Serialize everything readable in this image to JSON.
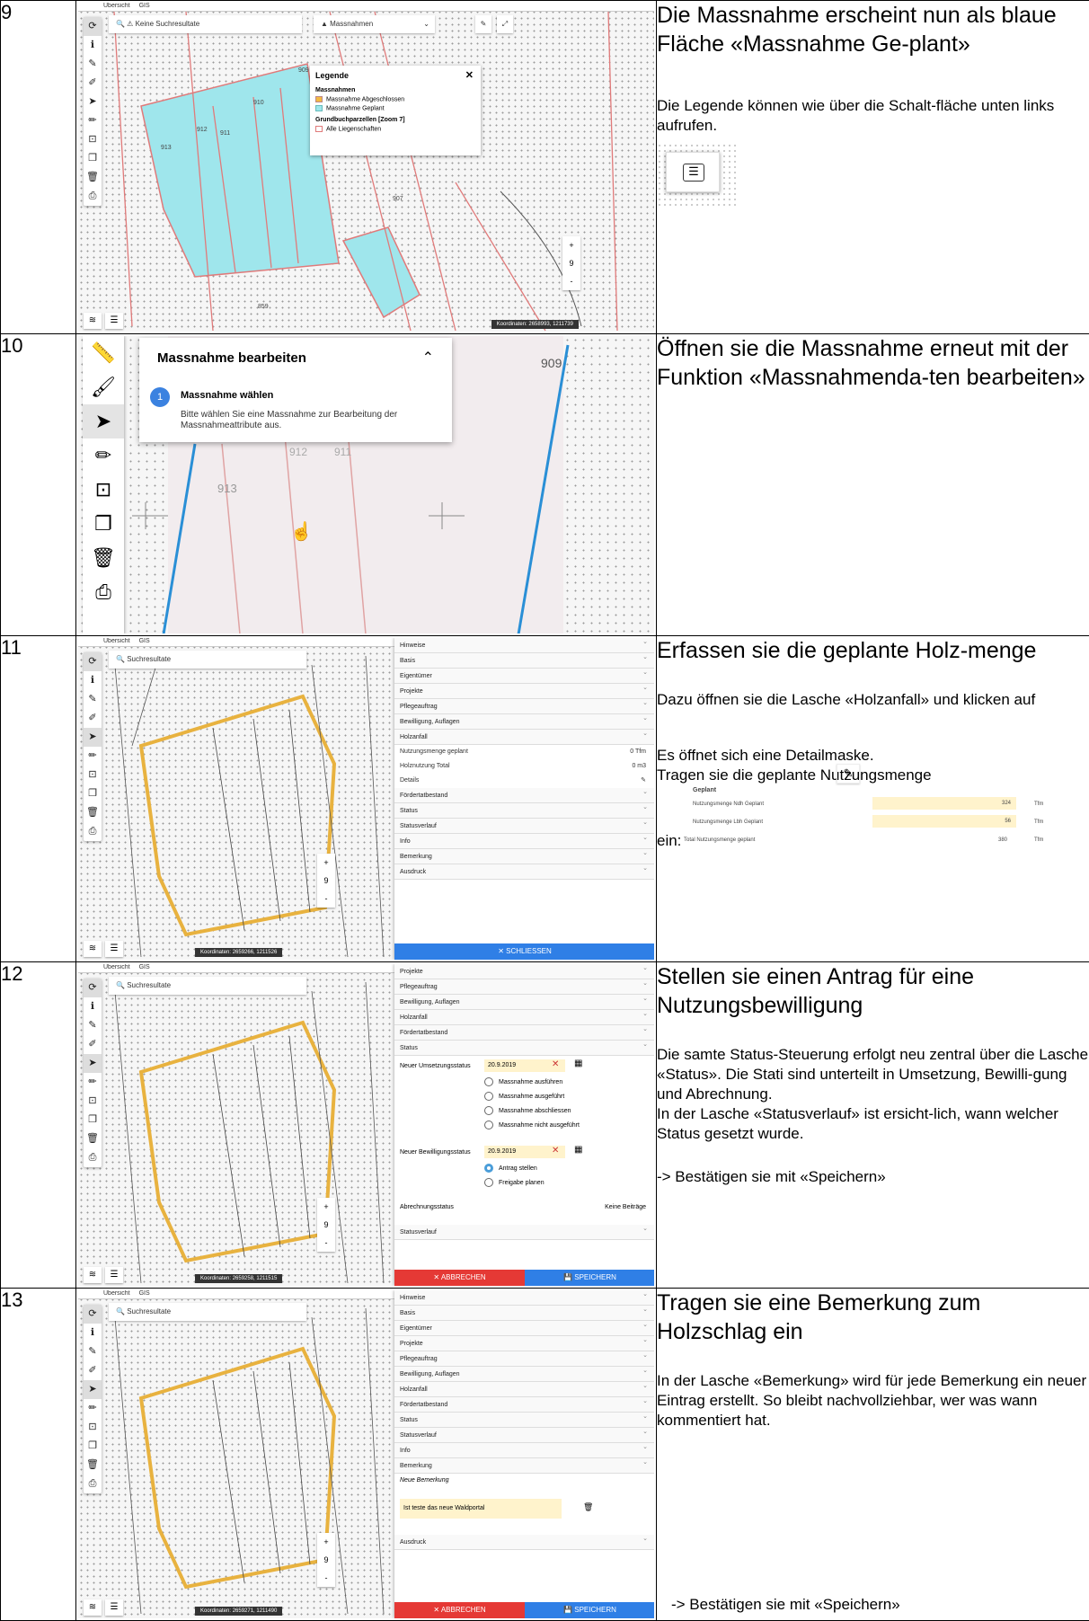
{
  "rows": [
    {
      "number": "9",
      "heading": "Die Massnahme erscheint nun als blaue Fläche «Massnahme Ge-plant»",
      "text1": "Die Legende können wie über die Schalt-fläche unten links aufrufen.",
      "shot": {
        "tabs": [
          "Übersicht",
          "GIS"
        ],
        "search_placeholder": "Keine Suchresultate",
        "layer_select": "Massnahmen",
        "legend": {
          "title": "Legende",
          "group1": "Massnahmen",
          "item1": "Massnahme Abgeschlossen",
          "item2": "Massnahme Geplant",
          "group2": "Grundbuchparzellen [Zoom 7]",
          "item3": "Alle Liegenschaften",
          "colors": {
            "abgeschlossen": "#f4b942",
            "geplant": "#9fe6ec",
            "liegenschaften": "#e07a7a"
          }
        },
        "parcels": [
          "910",
          "912",
          "911",
          "913",
          "907",
          "859",
          "909"
        ],
        "zoom_level": "9",
        "coords": "Koordinaten: 2658993, 1211739"
      }
    },
    {
      "number": "10",
      "heading": "Öffnen sie die Massnahme erneut mit der Funktion «Massnahmenda-ten bearbeiten»",
      "shot": {
        "dialog_title": "Massnahme bearbeiten",
        "step_number": "1",
        "step_title": "Massnahme wählen",
        "step_text": "Bitte wählen Sie eine Massnahme zur Bearbeitung der Massnahmeattribute aus.",
        "parcels": [
          "909",
          "912",
          "911",
          "913"
        ]
      }
    },
    {
      "number": "11",
      "heading": "Erfassen sie die geplante Holz-menge",
      "text1": "Dazu öffnen sie die Lasche «Holzanfall» und klicken auf",
      "text2": "Es öffnet sich eine Detailmaske.",
      "text3": "Tragen sie die geplante Nutzungsmenge",
      "text4": "ein:",
      "inset": {
        "title": "Geplant",
        "rows": [
          {
            "label": "Nutzungsmenge Ndh Geplant",
            "value": "324",
            "unit": "Tfm"
          },
          {
            "label": "Nutzungsmenge Lbh Geplant",
            "value": "56",
            "unit": "Tfm"
          },
          {
            "label": "Total Nutzungsmenge geplant",
            "value": "380",
            "unit": "Tfm"
          }
        ]
      },
      "shot": {
        "search_placeholder": "Suchresultate",
        "panel_sections_top": [
          "Hinweise",
          "Basis",
          "Eigentümer",
          "Projekte",
          "Pflegeauftrag",
          "Bewilligung, Auflagen",
          "Holzanfall"
        ],
        "details": [
          {
            "label": "Nutzungsmenge geplant",
            "value": "0 Tfm"
          },
          {
            "label": "Holznutzung Total",
            "value": "0 m3"
          },
          {
            "label": "Details",
            "value": ""
          }
        ],
        "panel_sections_bottom": [
          "Fördertatbestand",
          "Status",
          "Statusverlauf",
          "Info",
          "Bemerkung",
          "Ausdruck"
        ],
        "close_button": "✕ SCHLIESSEN",
        "coords": "Koordinaten: 2659266, 1211526"
      }
    },
    {
      "number": "12",
      "heading": "Stellen sie einen Antrag für eine Nutzungsbewilligung",
      "text1": "Die samte Status-Steuerung erfolgt neu zentral über die Lasche «Status». Die Stati sind unterteilt in Umsetzung, Bewilli-gung und Abrechnung.",
      "text2": "In der Lasche «Statusverlauf» ist ersicht-lich, wann welcher Status gesetzt wurde.",
      "text3": "-> Bestätigen sie mit «Speichern»",
      "shot": {
        "panel_sections_top": [
          "Projekte",
          "Pflegeauftrag",
          "Bewilligung, Auflagen",
          "Holzanfall",
          "Fördertatbestand",
          "Status"
        ],
        "umsetzung_label": "Neuer Umsetzungsstatus",
        "umsetzung_date": "20.9.2019",
        "umsetzung_options": [
          "Massnahme ausführen",
          "Massnahme ausgeführt",
          "Massnahme abschliessen",
          "Massnahme nicht ausgeführt"
        ],
        "bewilligung_label": "Neuer Bewilligungsstatus",
        "bewilligung_date": "20.9.2019",
        "bewilligung_options": [
          "Antrag stellen",
          "Freigabe planen"
        ],
        "abrechnung_label": "Abrechnungsstatus",
        "abrechnung_value": "Keine Beiträge",
        "statusverlauf": "Statusverlauf",
        "cancel": "✕ ABBRECHEN",
        "save": "SPEICHERN",
        "coords": "Koordinaten: 2659258, 1211515"
      }
    },
    {
      "number": "13",
      "heading": "Tragen sie eine Bemerkung zum Holzschlag ein",
      "text1": "In der Lasche «Bemerkung» wird für jede Bemerkung ein neuer Eintrag erstellt. So bleibt nachvollziehbar, wer was wann kommentiert hat.",
      "text2": "-> Bestätigen sie mit «Speichern»",
      "shot": {
        "panel_sections_top": [
          "Hinweise",
          "Basis",
          "Eigentümer",
          "Projekte",
          "Pflegeauftrag",
          "Bewilligung, Auflagen",
          "Holzanfall",
          "Fördertatbestand",
          "Status",
          "Statusverlauf",
          "Info",
          "Bemerkung"
        ],
        "new_comment_label": "Neue Bemerkung",
        "comment_text": "Ist teste das neue Waldportal",
        "ausdruck": "Ausdruck",
        "cancel": "✕ ABBRECHEN",
        "save": "SPEICHERN",
        "coords": "Koordinaten: 2659271, 1211490"
      }
    }
  ]
}
